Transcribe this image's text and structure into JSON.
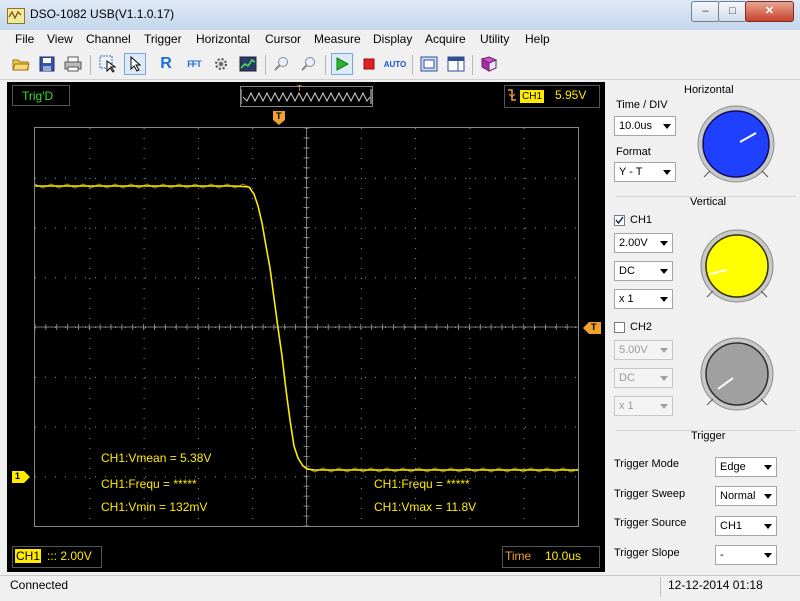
{
  "window": {
    "title": "DSO-1082 USB(V1.1.0.17)",
    "min_label": "–",
    "max_label": "□",
    "close_label": "✕"
  },
  "menu": [
    "File",
    "View",
    "Channel",
    "Trigger",
    "Horizontal",
    "Cursor",
    "Measure",
    "Display",
    "Acquire",
    "Utility",
    "Help"
  ],
  "toolbar": {
    "icons": [
      "open-icon",
      "save-icon",
      "print-icon",
      "select-zoom-icon",
      "pointer-icon",
      "reference-icon",
      "fft-icon",
      "settings-icon",
      "display-icon",
      "zoom-in-icon",
      "zoom-out-icon",
      "run-icon",
      "stop-icon",
      "auto-icon",
      "snapshot-icon",
      "layout-icon",
      "book-icon"
    ],
    "r_label": "R",
    "fft_label": "FFT",
    "auto_label": "AUTO"
  },
  "scope": {
    "trig_status": "Trig'D",
    "trigger_marker": "T",
    "trigger_channel": "CH1",
    "trigger_level": "5.95V",
    "ch1_marker": "1",
    "measurements_left": [
      "CH1:Vmean = 5.38V",
      "CH1:Frequ = *****",
      "CH1:Vmin = 132mV"
    ],
    "measurements_right": [
      "CH1:Frequ = *****",
      "CH1:Vmax = 11.8V"
    ],
    "bottom_channel": "CH1",
    "bottom_channel_scale": "::: 2.00V",
    "time_label": "Time",
    "time_value": "10.0us",
    "colors": {
      "trace": "#ffea00",
      "grid": "#9a9a9a",
      "background": "#000000"
    }
  },
  "horizontal": {
    "title": "Horizontal",
    "time_div_label": "Time / DIV",
    "time_div_value": "10.0us",
    "format_label": "Format",
    "format_value": "Y - T",
    "knob_color": "#2040ff"
  },
  "vertical": {
    "title": "Vertical",
    "ch1_label": "CH1",
    "ch1_checked": true,
    "ch1_volts": "2.00V",
    "ch1_coupling": "DC",
    "ch1_probe": "x 1",
    "ch1_knob_color": "#ffff00",
    "ch2_label": "CH2",
    "ch2_checked": false,
    "ch2_volts": "5.00V",
    "ch2_coupling": "DC",
    "ch2_probe": "x 1",
    "ch2_knob_color": "#a0a0a0"
  },
  "trigger": {
    "title": "Trigger",
    "mode_label": "Trigger Mode",
    "mode_value": "Edge",
    "sweep_label": "Trigger Sweep",
    "sweep_value": "Normal",
    "source_label": "Trigger Source",
    "source_value": "CH1",
    "slope_label": "Trigger Slope",
    "slope_value": "-"
  },
  "status": {
    "text": "Connected",
    "datetime": "12-12-2014  01:18"
  }
}
